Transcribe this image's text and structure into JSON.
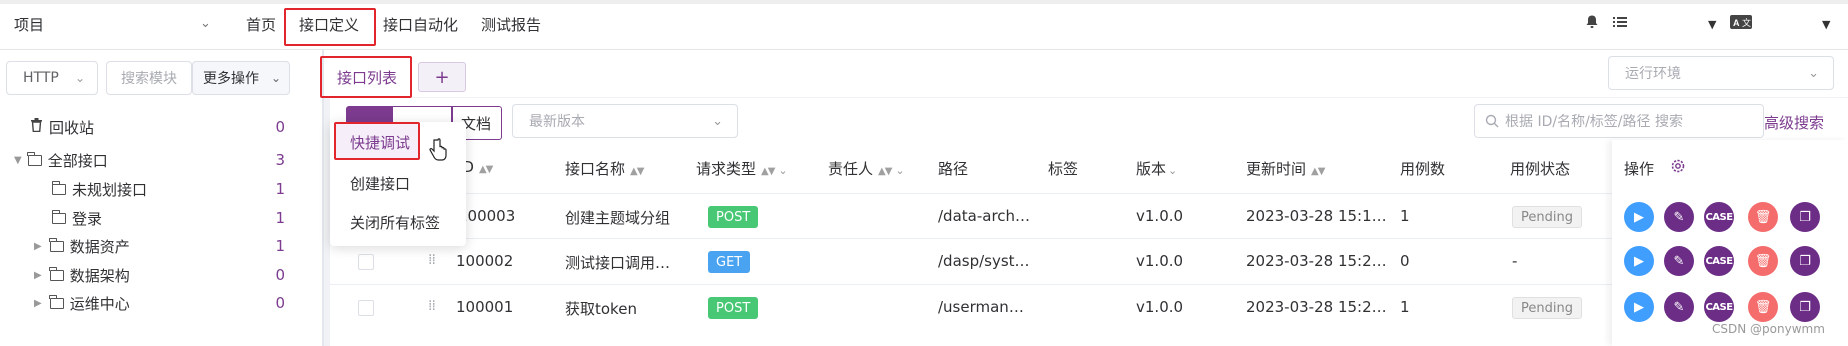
{
  "topbar": {
    "project_label": "项目",
    "nav": [
      "首页",
      "接口定义",
      "接口自动化",
      "测试报告"
    ]
  },
  "left": {
    "protocol": "HTTP",
    "search_placeholder": "搜索模块",
    "more_ops": "更多操作",
    "tree": [
      {
        "label": "回收站",
        "count": "0"
      },
      {
        "label": "全部接口",
        "count": "3"
      },
      {
        "label": "未规划接口",
        "count": "1"
      },
      {
        "label": "登录",
        "count": "1"
      },
      {
        "label": "数据资产",
        "count": "1"
      },
      {
        "label": "数据架构",
        "count": "0"
      },
      {
        "label": "运维中心",
        "count": "0"
      }
    ]
  },
  "tabs": {
    "list": "接口列表",
    "plus": "+"
  },
  "env_placeholder": "运行环境",
  "toolbar": {
    "doc_label": "文档",
    "version_placeholder": "最新版本",
    "search_placeholder": "根据 ID/名称/标签/路径 搜索",
    "advanced": "高级搜索"
  },
  "table": {
    "headers": [
      "ID",
      "接口名称",
      "请求类型",
      "责任人",
      "路径",
      "标签",
      "版本",
      "更新时间",
      "用例数",
      "用例状态",
      "操作"
    ],
    "rows": [
      {
        "id": "100003",
        "name": "创建主题域分组",
        "method": "POST",
        "path": "/data-arch…",
        "version": "v1.0.0",
        "updated": "2023-03-28 15:1…",
        "cases": "1",
        "status": "Pending"
      },
      {
        "id": "100002",
        "name": "测试接口调用…",
        "method": "GET",
        "path": "/dasp/syst…",
        "version": "v1.0.0",
        "updated": "2023-03-28 15:2…",
        "cases": "0",
        "status": "-"
      },
      {
        "id": "100001",
        "name": "获取token",
        "method": "POST",
        "path": "/userman…",
        "version": "v1.0.0",
        "updated": "2023-03-28 15:2…",
        "cases": "1",
        "status": "Pending"
      }
    ],
    "case_label": "CASE"
  },
  "dropdown": [
    "快捷调试",
    "创建接口",
    "关闭所有标签"
  ],
  "watermark": "CSDN @ponywmm",
  "colors": {
    "accent": "#7c3b8f",
    "post": "#48c774",
    "get": "#4aa3f0",
    "highlight": "#e2242d"
  }
}
